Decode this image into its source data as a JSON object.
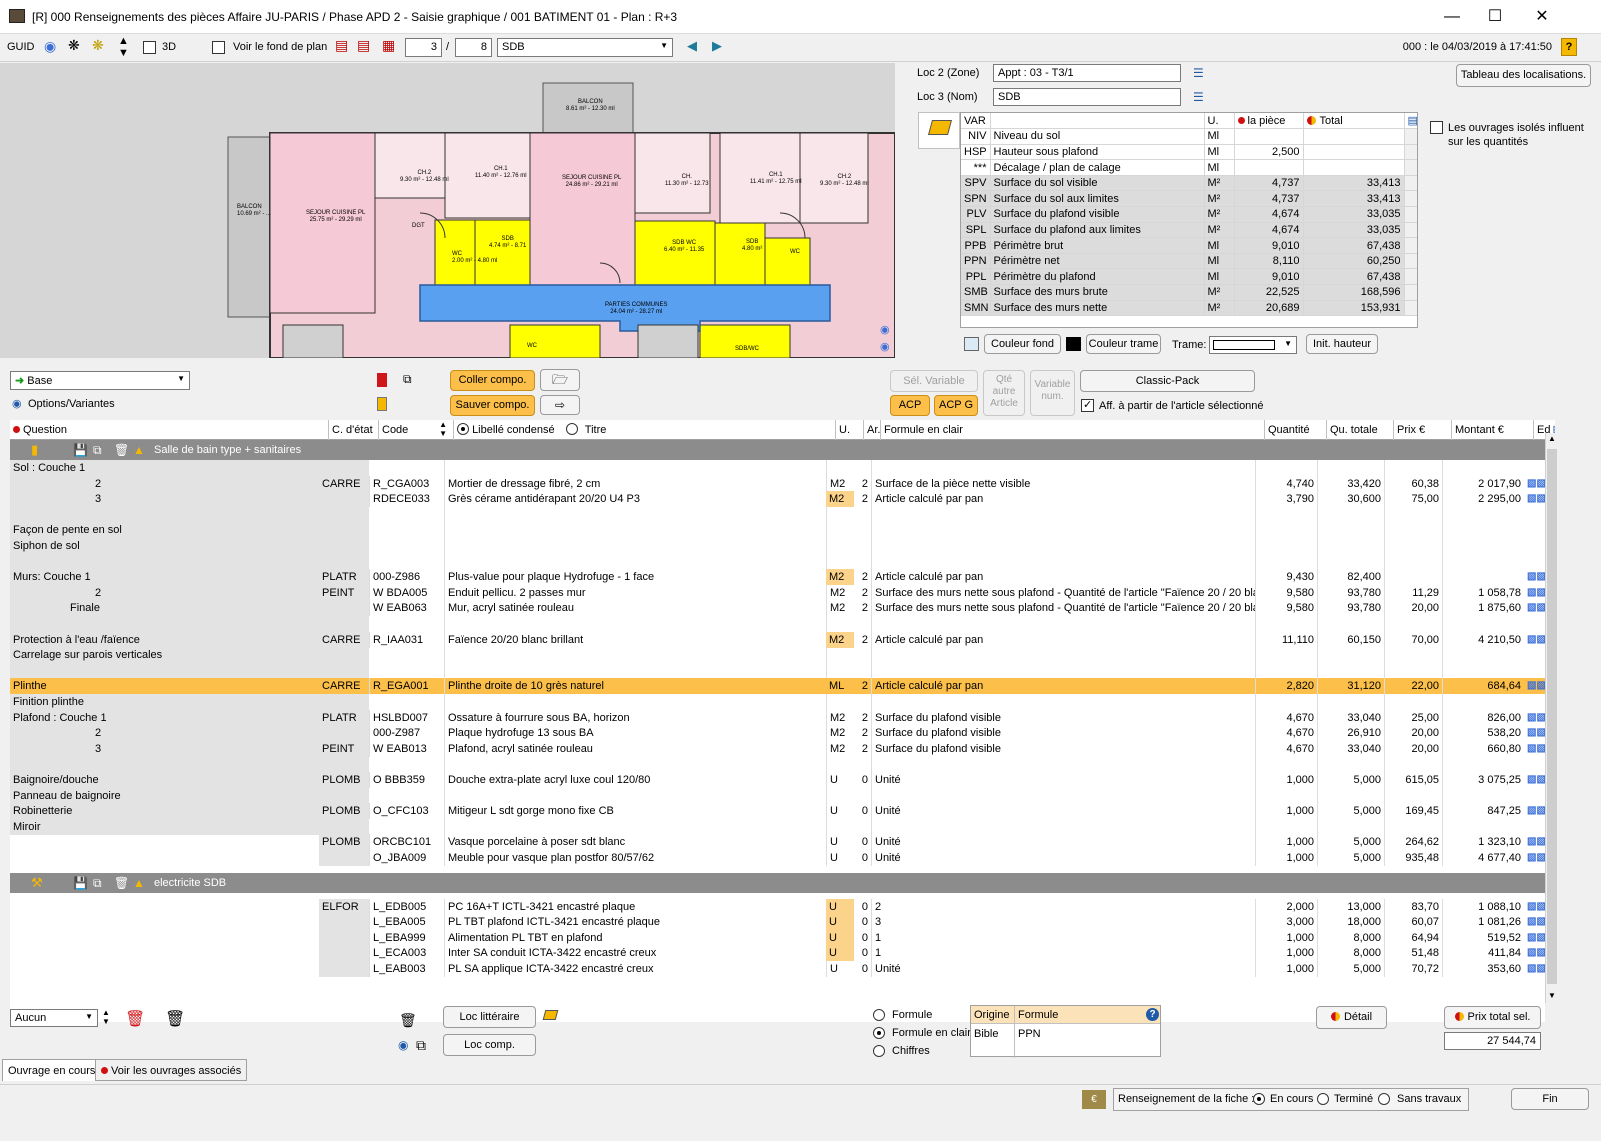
{
  "window": {
    "title": "[R] 000 Renseignements des pièces   Affaire JU-PARIS / Phase APD 2 - Saisie graphique / 001 BATIMENT 01 - Plan : R+3"
  },
  "toolbar": {
    "guid": "GUID",
    "label_3d": "3D",
    "voir_fond": "Voir le fond de plan",
    "page_current": "3",
    "page_sep": "/",
    "page_total": "8",
    "room_select": "SDB",
    "datetime": "000 : le 04/03/2019 à 17:41:50"
  },
  "loc": {
    "loc2_label": "Loc 2 (Zone)",
    "loc2_value": "Appt : 03 - T3/1",
    "loc3_label": "Loc 3 (Nom)",
    "loc3_value": "SDB",
    "tableau_btn": "Tableau des localisations."
  },
  "props": {
    "headers": [
      "VAR",
      "U.",
      "la pièce",
      "Total"
    ],
    "rows": [
      [
        "NIV",
        "Niveau du sol",
        "Ml",
        "",
        ""
      ],
      [
        "HSP",
        "Hauteur sous plafond",
        "Ml",
        "2,500",
        ""
      ],
      [
        "***",
        "Décalage / plan de calage",
        "Ml",
        "",
        ""
      ],
      [
        "SPV",
        "Surface du sol visible",
        "M²",
        "4,737",
        "33,413"
      ],
      [
        "SPN",
        "Surface du sol aux limites",
        "M²",
        "4,737",
        "33,413"
      ],
      [
        "PLV",
        "Surface du plafond visible",
        "M²",
        "4,674",
        "33,035"
      ],
      [
        "SPL",
        "Surface du plafond aux limites",
        "M²",
        "4,674",
        "33,035"
      ],
      [
        "PPB",
        "Périmètre brut",
        "Ml",
        "9,010",
        "67,438"
      ],
      [
        "PPN",
        "Périmètre net",
        "Ml",
        "8,110",
        "60,250"
      ],
      [
        "PPL",
        "Périmètre du plafond",
        "Ml",
        "9,010",
        "67,438"
      ],
      [
        "SMB",
        "Surface des murs brute",
        "M²",
        "22,525",
        "168,596"
      ],
      [
        "SMN",
        "Surface des murs nette",
        "M²",
        "20,689",
        "153,931"
      ]
    ],
    "isoles": "Les ouvrages isolés influent sur les quantités",
    "couleur_fond": "Couleur fond",
    "couleur_trame": "Couleur trame",
    "trame": "Trame:",
    "init_hauteur": "Init. hauteur"
  },
  "plan": {
    "rooms": [
      "BALCON",
      "8.61 m² - 12.30 ml",
      "BALCON",
      "10.69 m² - ...",
      "SEJOUR CUISINE PL",
      "25.75 m² - 29.29 ml",
      "CH.2",
      "9.30 m² - 12.48 ml",
      "CH.1",
      "11.40 m² - 12.76 ml",
      "SEJOUR CUISINE PL",
      "24.86 m² - 29.21 ml",
      "CH.",
      "11.30 m² - 12.73",
      "CH.1",
      "11.41 m² - 12.75 ml",
      "CH.2",
      "9.30 m² - 12.48 ml",
      "DGT",
      "SDB",
      "4.74 m² - 8.71",
      "WC",
      "2.00 m² - 4.80 ml",
      "SDB WC",
      "6.40 m² - 11.35",
      "SDB",
      "4.80 m²",
      "WC",
      "PARTIES COMMUNES",
      "24.04 m² - 28.27 ml",
      "WC",
      "SDB/WC"
    ]
  },
  "compo": {
    "base": "Base",
    "options": "Options/Variantes",
    "coller": "Coller compo.",
    "sauver": "Sauver compo.",
    "sel_variable": "Sél. Variable",
    "qte_autre": "Qté autre Article",
    "variable_num": "Variable num.",
    "classic_pack": "Classic-Pack",
    "acp": "ACP",
    "acpg": "ACP G",
    "aff": "Aff. à partir de l'article sélectionné"
  },
  "grid_headers": {
    "question": "Question",
    "cetat": "C. d'état",
    "code": "Code",
    "libelle": "Libellé condensé",
    "titre": "Titre",
    "u": "U.",
    "ar": "Ar.",
    "formule": "Formule en clair",
    "quantite": "Quantité",
    "qu_totale": "Qu. totale",
    "prix": "Prix €",
    "montant": "Montant €",
    "ed": "Ed"
  },
  "groups": [
    {
      "title": "Salle de bain type + sanitaires"
    },
    {
      "title": "electricite SDB"
    }
  ],
  "rows": [
    {
      "q": "Sol :        Couche 1",
      "c": "",
      "code": "",
      "lib": "",
      "u": "",
      "ar": "",
      "f": "",
      "qt": "",
      "qtot": "",
      "px": "",
      "mt": ""
    },
    {
      "q": "2",
      "qi": 1,
      "c": "CARRE",
      "code": "R_CGA003",
      "lib": "Mortier de dressage fibré, 2 cm",
      "u": "M2",
      "ar": "2",
      "f": "Surface de la pièce nette visible",
      "qt": "4,740",
      "qtot": "33,420",
      "px": "60,38",
      "mt": "2 017,90"
    },
    {
      "q": "3",
      "qi": 1,
      "c": "",
      "code": "RDECE033",
      "lib": "Grès cérame antidérapant 20/20 U4 P3",
      "u": "M2",
      "uo": 1,
      "ar": "2",
      "f": "Article calculé par pan",
      "qt": "3,790",
      "qtot": "30,600",
      "px": "75,00",
      "mt": "2 295,00"
    },
    {
      "q": "",
      "c": "",
      "code": "",
      "lib": "",
      "u": "",
      "ar": "",
      "f": "",
      "qt": "",
      "qtot": "",
      "px": "",
      "mt": ""
    },
    {
      "q": "Façon de pente en sol",
      "c": "",
      "code": "",
      "lib": "",
      "u": "",
      "ar": "",
      "f": "",
      "qt": "",
      "qtot": "",
      "px": "",
      "mt": ""
    },
    {
      "q": "Siphon de sol",
      "c": "",
      "code": "",
      "lib": "",
      "u": "",
      "ar": "",
      "f": "",
      "qt": "",
      "qtot": "",
      "px": "",
      "mt": ""
    },
    {
      "q": "",
      "c": "",
      "code": "",
      "lib": "",
      "u": "",
      "ar": "",
      "f": "",
      "qt": "",
      "qtot": "",
      "px": "",
      "mt": ""
    },
    {
      "q": "Murs:      Couche 1",
      "c": "PLATR",
      "code": "000-Z986",
      "lib": "Plus-value pour plaque Hydrofuge - 1 face",
      "u": "M2",
      "uo": 1,
      "ar": "2",
      "f": "Article calculé par pan",
      "qt": "9,430",
      "qtot": "82,400",
      "px": "",
      "mt": ""
    },
    {
      "q": "2",
      "qi": 1,
      "c": "PEINT",
      "code": "W BDA005",
      "lib": "Enduit pellicu. 2 passes mur",
      "u": "M2",
      "ar": "2",
      "f": "Surface des murs nette sous plafond - Quantité de l'article \"Faïence 20 / 20 blanc",
      "qt": "9,580",
      "qtot": "93,780",
      "px": "11,29",
      "mt": "1 058,78"
    },
    {
      "q": "Finale",
      "qi": 2,
      "c": "",
      "code": "W EAB063",
      "lib": "Mur, acryl satinée rouleau",
      "u": "M2",
      "ar": "2",
      "f": "Surface des murs nette sous plafond - Quantité de l'article \"Faïence 20 / 20 blanc",
      "qt": "9,580",
      "qtot": "93,780",
      "px": "20,00",
      "mt": "1 875,60"
    },
    {
      "q": "",
      "c": "",
      "code": "",
      "lib": "",
      "u": "",
      "ar": "",
      "f": "",
      "qt": "",
      "qtot": "",
      "px": "",
      "mt": ""
    },
    {
      "q": "Protection à l'eau /faïence",
      "c": "CARRE",
      "code": "R_IAA031",
      "lib": "Faïence 20/20 blanc brillant",
      "u": "M2",
      "uo": 1,
      "ar": "2",
      "f": "Article calculé par pan",
      "qt": "11,110",
      "qtot": "60,150",
      "px": "70,00",
      "mt": "4 210,50"
    },
    {
      "q": "Carrelage sur parois verticales",
      "c": "",
      "code": "",
      "lib": "",
      "u": "",
      "ar": "",
      "f": "",
      "qt": "",
      "qtot": "",
      "px": "",
      "mt": ""
    },
    {
      "q": "",
      "c": "",
      "code": "",
      "lib": "",
      "u": "",
      "ar": "",
      "f": "",
      "qt": "",
      "qtot": "",
      "px": "",
      "mt": ""
    },
    {
      "q": "Plinthe",
      "sel": 1,
      "c": "CARRE",
      "code": "R_EGA001",
      "lib": "Plinthe droite de 10 grès naturel",
      "u": "ML",
      "ar": "2",
      "f": "Article calculé par pan",
      "qt": "2,820",
      "qtot": "31,120",
      "px": "22,00",
      "mt": "684,64"
    },
    {
      "q": "Finition plinthe",
      "c": "",
      "code": "",
      "lib": "",
      "u": "",
      "ar": "",
      "f": "",
      "qt": "",
      "qtot": "",
      "px": "",
      "mt": ""
    },
    {
      "q": "Plafond :  Couche 1",
      "c": "PLATR",
      "code": "HSLBD007",
      "lib": "Ossature à fourrure sous BA, horizon",
      "u": "M2",
      "ar": "2",
      "f": "Surface du plafond visible",
      "qt": "4,670",
      "qtot": "33,040",
      "px": "25,00",
      "mt": "826,00"
    },
    {
      "q": "2",
      "qi": 1,
      "c": "",
      "code": "000-Z987",
      "lib": "Plaque hydrofuge 13 sous BA",
      "u": "M2",
      "ar": "2",
      "f": "Surface du plafond visible",
      "qt": "4,670",
      "qtot": "26,910",
      "px": "20,00",
      "mt": "538,20"
    },
    {
      "q": "3",
      "qi": 1,
      "c": "PEINT",
      "code": "W EAB013",
      "lib": "Plafond, acryl satinée rouleau",
      "u": "M2",
      "ar": "2",
      "f": "Surface du plafond visible",
      "qt": "4,670",
      "qtot": "33,040",
      "px": "20,00",
      "mt": "660,80"
    },
    {
      "q": "",
      "c": "",
      "code": "",
      "lib": "",
      "u": "",
      "ar": "",
      "f": "",
      "qt": "",
      "qtot": "",
      "px": "",
      "mt": ""
    },
    {
      "q": "Baignoire/douche",
      "c": "PLOMB",
      "code": "O BBB359",
      "lib": "Douche extra-plate acryl luxe coul 120/80",
      "u": "U",
      "ar": "0",
      "f": "Unité",
      "qt": "1,000",
      "qtot": "5,000",
      "px": "615,05",
      "mt": "3 075,25"
    },
    {
      "q": "Panneau de baignoire",
      "c": "",
      "code": "",
      "lib": "",
      "u": "",
      "ar": "",
      "f": "",
      "qt": "",
      "qtot": "",
      "px": "",
      "mt": ""
    },
    {
      "q": "Robinetterie",
      "c": "PLOMB",
      "code": "O_CFC103",
      "lib": "Mitigeur L sdt gorge mono fixe CB",
      "u": "U",
      "ar": "0",
      "f": "Unité",
      "qt": "1,000",
      "qtot": "5,000",
      "px": "169,45",
      "mt": "847,25"
    },
    {
      "q": "Miroir",
      "c": "",
      "code": "",
      "lib": "",
      "u": "",
      "ar": "",
      "f": "",
      "qt": "",
      "qtot": "",
      "px": "",
      "mt": ""
    },
    {
      "q": "",
      "nq": 1,
      "c": "PLOMB",
      "code": "ORCBC101",
      "lib": "Vasque porcelaine à poser sdt blanc",
      "u": "U",
      "ar": "0",
      "f": "Unité",
      "qt": "1,000",
      "qtot": "5,000",
      "px": "264,62",
      "mt": "1 323,10"
    },
    {
      "q": "",
      "nq": 1,
      "c": "",
      "code": "O_JBA009",
      "lib": "Meuble pour vasque plan postfor 80/57/62",
      "u": "U",
      "ar": "0",
      "f": "Unité",
      "qt": "1,000",
      "qtot": "5,000",
      "px": "935,48",
      "mt": "4 677,40"
    }
  ],
  "rows2": [
    {
      "c": "ELFOR",
      "code": "L_EDB005",
      "lib": "PC 16A+T ICTL-3421 encastré plaque",
      "u": "U",
      "uo": 1,
      "ar": "0",
      "f": "2",
      "qt": "2,000",
      "qtot": "13,000",
      "px": "83,70",
      "mt": "1 088,10"
    },
    {
      "c": "",
      "code": "L_EBA005",
      "lib": "PL TBT plafond ICTL-3421 encastré plaque",
      "u": "U",
      "uo": 1,
      "ar": "0",
      "f": "3",
      "qt": "3,000",
      "qtot": "18,000",
      "px": "60,07",
      "mt": "1 081,26"
    },
    {
      "c": "",
      "code": "L_EBA999",
      "lib": "Alimentation PL TBT en plafond",
      "u": "U",
      "uo": 1,
      "ar": "0",
      "f": "1",
      "qt": "1,000",
      "qtot": "8,000",
      "px": "64,94",
      "mt": "519,52"
    },
    {
      "c": "",
      "code": "L_ECA003",
      "lib": "Inter SA conduit ICTA-3422 encastré creux",
      "u": "U",
      "uo": 1,
      "ar": "0",
      "f": "1",
      "qt": "1,000",
      "qtot": "8,000",
      "px": "51,48",
      "mt": "411,84"
    },
    {
      "c": "",
      "code": "L_EAB003",
      "lib": "PL SA applique ICTA-3422 encastré creux",
      "u": "U",
      "ar": "0",
      "f": "Unité",
      "qt": "1,000",
      "qtot": "5,000",
      "px": "70,72",
      "mt": "353,60"
    }
  ],
  "bottom": {
    "aucun": "Aucun",
    "loc_litteraire": "Loc littéraire",
    "loc_comp": "Loc comp.",
    "radio_formule": "Formule",
    "radio_formule_clair": "Formule en clair",
    "radio_chiffres": "Chiffres",
    "orig_hd": "Origine",
    "form_hd": "Formule",
    "orig_val": "Bible",
    "form_val": "PPN",
    "detail": "Détail",
    "prix_total": "Prix total sel.",
    "total_value": "27 544,74"
  },
  "tabs": {
    "ouvrage": "Ouvrage en cours",
    "voir": "Voir les ouvrages associés"
  },
  "status": {
    "renseignement": "Renseignement de la fiche :",
    "en_cours": "En cours",
    "termine": "Terminé",
    "sans_travaux": "Sans travaux",
    "fin": "Fin"
  }
}
